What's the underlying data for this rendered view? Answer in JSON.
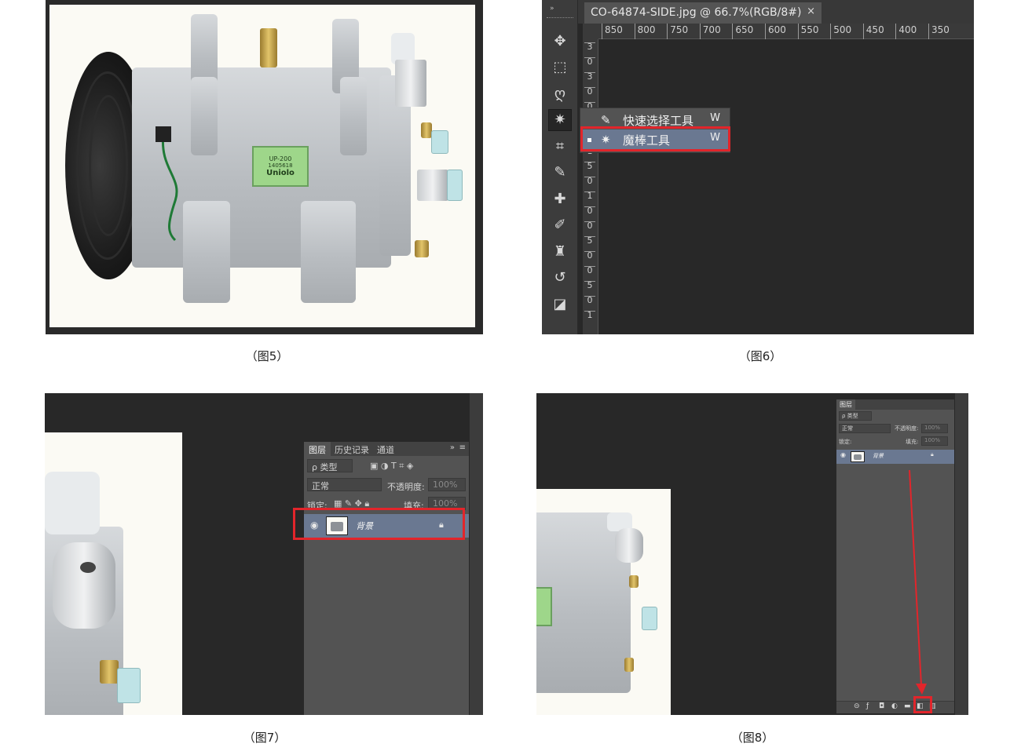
{
  "captions": {
    "fig5": "（图5）",
    "fig6": "（图6）",
    "fig7": "（图7）",
    "fig8": "（图8）"
  },
  "product": {
    "label_model": "UP-200",
    "label_serial": "1405618",
    "label_brand": "Uniolo"
  },
  "fig6": {
    "tab_title": "CO-64874-SIDE.jpg @ 66.7%(RGB/8#)",
    "tab_close": "×",
    "ruler_h": [
      "850",
      "800",
      "750",
      "700",
      "650",
      "600",
      "550",
      "500",
      "450",
      "400",
      "350"
    ],
    "ruler_v": [
      "3",
      "0",
      "3",
      "0",
      "0",
      "2",
      "5",
      "1",
      "5",
      "0",
      "1",
      "0",
      "0",
      "5",
      "0",
      "0",
      "5",
      "0",
      "1"
    ],
    "tools": [
      {
        "icon": "move-icon",
        "glyph": "✥"
      },
      {
        "icon": "marquee-icon",
        "glyph": "⬚"
      },
      {
        "icon": "lasso-icon",
        "glyph": "ღ"
      },
      {
        "icon": "magic-wand-icon",
        "glyph": "✷"
      },
      {
        "icon": "crop-icon",
        "glyph": "⌗"
      },
      {
        "icon": "eyedropper-icon",
        "glyph": "✎"
      },
      {
        "icon": "healing-brush-icon",
        "glyph": "✚"
      },
      {
        "icon": "brush-icon",
        "glyph": "✐"
      },
      {
        "icon": "stamp-icon",
        "glyph": "♜"
      },
      {
        "icon": "history-brush-icon",
        "glyph": "↺"
      },
      {
        "icon": "eraser-icon",
        "glyph": "◪"
      }
    ],
    "flyout": [
      {
        "label": "快速选择工具",
        "key": "W"
      },
      {
        "label": "魔棒工具",
        "key": "W"
      }
    ]
  },
  "layers_panel": {
    "tabs": [
      "图层",
      "历史记录",
      "通道"
    ],
    "filter_label": "ρ 类型",
    "blend_mode": "正常",
    "opacity_label": "不透明度:",
    "opacity_value": "100%",
    "lock_label": "锁定:",
    "fill_label": "填充:",
    "fill_value": "100%",
    "layer_name": "背景"
  },
  "colors": {
    "accent_red": "#e2252b",
    "selection_blue": "#6a7891",
    "ps_dark": "#282828",
    "panel_grey": "#535353"
  }
}
